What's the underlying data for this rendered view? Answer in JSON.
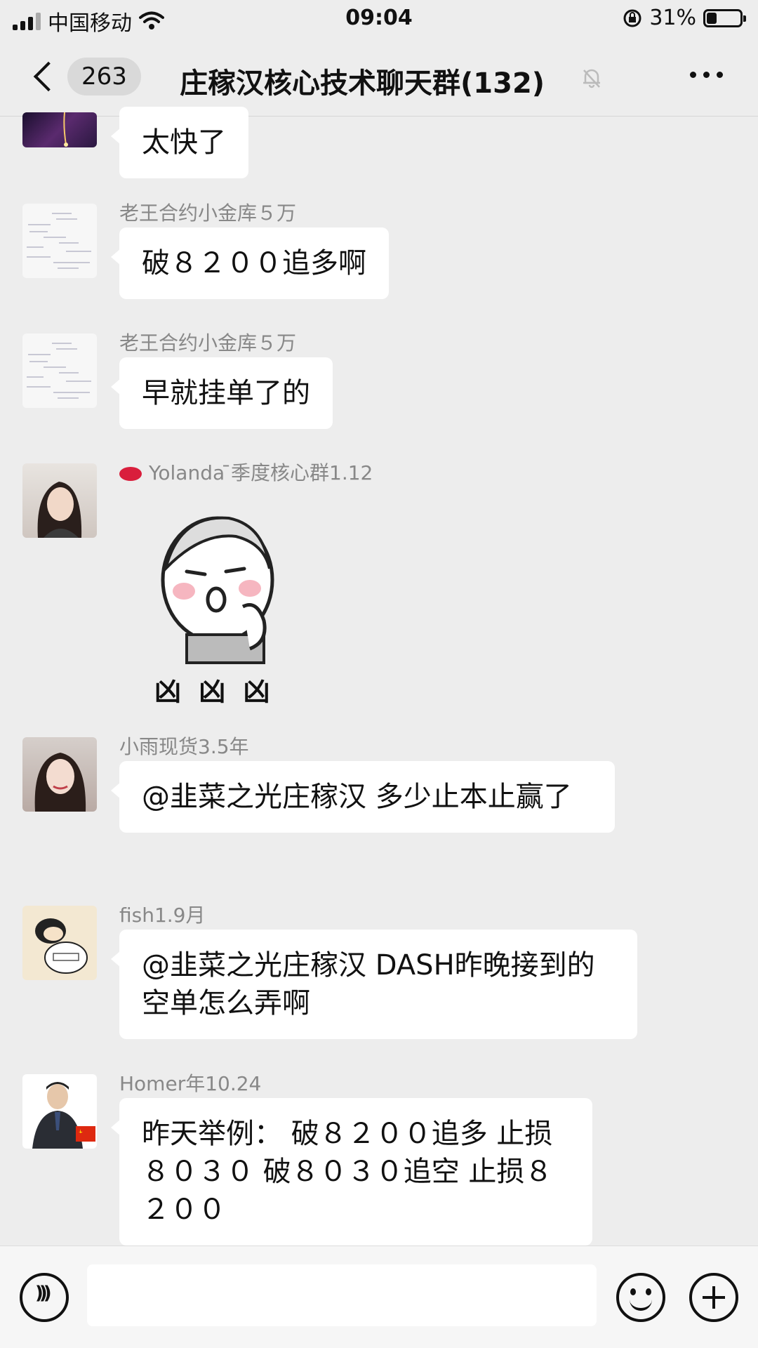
{
  "status_bar": {
    "carrier": "中国移动",
    "time": "09:04",
    "battery": "31%",
    "battery_level": 0.31
  },
  "nav": {
    "unread_count": "263",
    "title": "庄稼汉核心技术聊天群(132)"
  },
  "messages": [
    {
      "sender": "",
      "text": "太快了"
    },
    {
      "sender": "老王合约小金库５万",
      "text": "破８２００追多啊"
    },
    {
      "sender": "老王合约小金库５万",
      "text": "早就挂单了的"
    },
    {
      "sender": "Yolanda ̄季度核心群1.12",
      "sticker_caption": "凶 凶 凶"
    },
    {
      "sender": "小雨现货3.5年",
      "text": "@韭菜之光庄稼汉 多少止本止赢了"
    },
    {
      "sender": "fish1.9月",
      "text": "@韭菜之光庄稼汉 DASH昨晚接到的空单怎么弄啊"
    },
    {
      "sender": "Homer年10.24",
      "text": "昨天举例： 破８２００追多 止损８０３０ 破８０３０追空 止损８２００"
    }
  ],
  "icons": {
    "voice": "voice-icon",
    "emoji": "emoji-icon",
    "plus": "plus-icon",
    "mute": "mute-bell-icon",
    "more": "more-icon"
  }
}
